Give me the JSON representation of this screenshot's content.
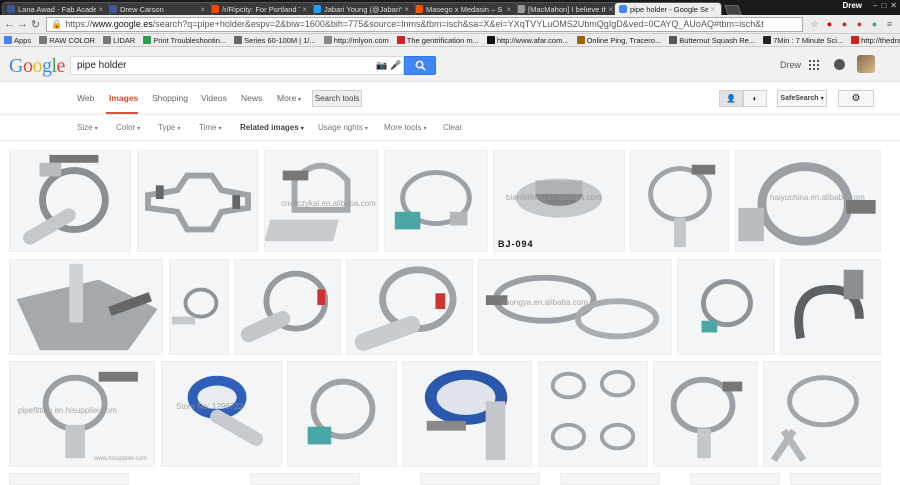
{
  "browser": {
    "tabs": [
      {
        "label": "Lana Awad - Fab Academ",
        "color": "#3b5998",
        "active": false
      },
      {
        "label": "Drew Carson",
        "color": "#3b5998",
        "active": false
      },
      {
        "label": "/r/Ripcity: For Portland Tr",
        "color": "#ff4500",
        "active": false
      },
      {
        "label": "Jabari Young (@JabariYo",
        "color": "#1da1f2",
        "active": false
      },
      {
        "label": "Masego x Medasin – S",
        "color": "#ff5500",
        "active": false
      },
      {
        "label": "[MacMahon] I believe tha",
        "color": "#999999",
        "active": false
      },
      {
        "label": "pipe holder - Google Sear",
        "color": "#4285f4",
        "active": true
      }
    ],
    "user": "Drew",
    "url_scheme": "https://",
    "url_host": "www.google.es",
    "url_rest": "/search?q=pipe+holder&espv=2&biw=1600&bih=775&source=lnms&tbm=isch&sa=X&ei=YXqTVYLuOMS2UbmQgIgD&ved=0CAYQ_AUoAQ#tbm=isch&t",
    "bookmarks": [
      {
        "label": "Apps",
        "color": "#4285f4"
      },
      {
        "label": "RAW COLOR",
        "color": "#777777"
      },
      {
        "label": "LIDAR",
        "color": "#777777"
      },
      {
        "label": "Print Troubleshootin...",
        "color": "#2a9d4a"
      },
      {
        "label": "Series 60-100M | 1/...",
        "color": "#666666"
      },
      {
        "label": "http://mlyon.com",
        "color": "#888888"
      },
      {
        "label": "The gentrification m...",
        "color": "#cc2222"
      },
      {
        "label": "http://www.afar.com...",
        "color": "#111111"
      },
      {
        "label": "Online Ping, Tracero...",
        "color": "#996600"
      },
      {
        "label": "Butternut Squash Re...",
        "color": "#555555"
      },
      {
        "label": "7Min : 7 Minute Sci...",
        "color": "#222222"
      },
      {
        "label": "http://thedraftery.co...",
        "color": "#cc2222"
      }
    ]
  },
  "google": {
    "logo_letters": [
      {
        "ch": "G",
        "color": "#4285f4"
      },
      {
        "ch": "o",
        "color": "#ea4335"
      },
      {
        "ch": "o",
        "color": "#fbbc05"
      },
      {
        "ch": "g",
        "color": "#4285f4"
      },
      {
        "ch": "l",
        "color": "#34a853"
      },
      {
        "ch": "e",
        "color": "#ea4335"
      }
    ],
    "query": "pipe holder",
    "user": "Drew",
    "nav_tabs": [
      "Web",
      "Images",
      "Shopping",
      "Videos",
      "News",
      "More",
      "Search tools"
    ],
    "safe_search": "SafeSearch",
    "filters": [
      "Size",
      "Color",
      "Type",
      "Time",
      "Related images",
      "Usage rights",
      "More tools",
      "Clear"
    ],
    "watermarks": {
      "t3": "cnwiczykai.en.alibaba.com",
      "t5": "bianfeifeng.en.alibaba.com",
      "t5_code": "BJ-094",
      "t7": "haiyuchina.en.alibaba.com",
      "t12": "chongya.en.alibaba.com",
      "t16": "pipefitting.en.hisupplier.com",
      "t16b": "www.hisupplier.com",
      "t17": "Store No: 1296722"
    }
  },
  "colors": {
    "accent": "#dd4b39",
    "button": "#4285f4"
  }
}
